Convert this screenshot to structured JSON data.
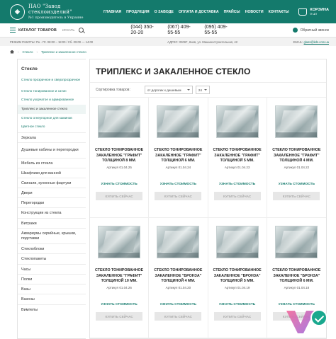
{
  "header": {
    "logo_name": "ПАО \"Завод стеклоизделий\"",
    "logo_sub": "№1 производитель в Украине",
    "nav": [
      "ГЛАВНАЯ",
      "ПРОДУКЦИЯ",
      "О ЗАВОДЕ",
      "ОПЛАТА И ДОСТАВКА",
      "ПРАЙСЫ",
      "НОВОСТИ",
      "КОНТАКТЫ"
    ],
    "cart_label": "КОРЗИНА",
    "cart_sub": "0 Шт"
  },
  "bar2": {
    "catalog_label": "КАТАЛОГ ТОВАРОВ",
    "search_placeholder": "ИСКАТЬ",
    "phones": [
      "(044) 350-20-20",
      "(067) 409-55-55",
      "(095) 409-55-55"
    ],
    "callback_label": "Обратный звонок"
  },
  "info": {
    "hours": "РЕЖИМ РАБОТЫ: Пн - Пт. 08:00 – 18:00 / Сб. 09:00 — 14:00",
    "address": "АДРЕС: 03067, Киев, ул. Машиностроительная, 42",
    "email_label": "EMAIL:",
    "email": "glass@kds.com.ua"
  },
  "breadcrumb": [
    "Стекло",
    "Триплекс и закаленное стекло"
  ],
  "sidebar": {
    "heading": "Стекло",
    "subitems": [
      "Стекло прозрачное и сверхпрозрачное",
      "Стекло тонированное и сатин",
      "Стекло узорчатое и армированное",
      "Триплекс и закаленное стекло",
      "Стекло огнеупорное для каминов",
      "Цветное стекло"
    ],
    "categories": [
      "Зеркала",
      "Душевые кабины и перегородки",
      "Мебель из стекла",
      "Шкафчики для ванной",
      "Скинали, кухонные фартуки",
      "Двери",
      "Перегородки",
      "Конструкции из стекла",
      "Витражи",
      "Аквариумы серийные, крышки, подставки",
      "Стеклоблоки",
      "Стеклопакеты",
      "Часы",
      "Полки",
      "Вазы",
      "Вазоны",
      "Вимпелы"
    ]
  },
  "content": {
    "title": "ТРИПЛЕКС И ЗАКАЛЕННОЕ СТЕКЛО",
    "sort_label": "Сортировка товаров:",
    "sort_value": "от дорогих к дешевым",
    "per_page": "24",
    "price_label": "УЗНАТЬ СТОИМОСТЬ",
    "buy_label": "КУПИТЬ СЕЙЧАС",
    "products": [
      {
        "name": "СТЕКЛО ТОНИРОВАННОЕ ЗАКАЛЕННОЕ \"ГРАФИТ\" ТОЛЩИНОЙ 8 ММ.",
        "article": "Артикул 01.04.25"
      },
      {
        "name": "СТЕКЛО ТОНИРОВАННОЕ ЗАКАЛЕННОЕ \"ГРАФИТ\" ТОЛЩИНОЙ 6 ММ.",
        "article": "Артикул 01.04.24"
      },
      {
        "name": "СТЕКЛО ТОНИРОВАННОЕ ЗАКАЛЕННОЕ \"ГРАФИТ\" ТОЛЩИНОЙ 5 ММ.",
        "article": "Артикул 01.04.23"
      },
      {
        "name": "СТЕКЛО ТОНИРОВАННОЕ ЗАКАЛЕННОЕ \"ГРАФИТ\" ТОЛЩИНОЙ 4 ММ.",
        "article": "Артикул 01.04.22"
      },
      {
        "name": "СТЕКЛО ТОНИРОВАННОЕ ЗАКАЛЕННОЕ \"ГРАФИТ\" ТОЛЩИНОЙ 10 ММ.",
        "article": "Артикул 01.04.26"
      },
      {
        "name": "СТЕКЛО ТОНИРОВАННОЕ ЗАКАЛЕННОЕ \"БРОНЗА\" ТОЛЩИНОЙ 4 ММ.",
        "article": "Артикул 01.04.20"
      },
      {
        "name": "СТЕКЛО ТОНИРОВАННОЕ ЗАКАЛЕННОЕ \"БРОНЗА\" ТОЛЩИНОЙ 5 ММ.",
        "article": "Артикул 01.04.19"
      },
      {
        "name": "СТЕКЛО ТОНИРОВАННОЕ ЗАКАЛЕННОЕ \"БРОНЗА\" ТОЛЩИНОЙ 6 ММ.",
        "article": "Артикул 01.04.18"
      }
    ]
  },
  "colors": {
    "brand": "#147a6c",
    "button_bg": "#e7e7e7"
  }
}
